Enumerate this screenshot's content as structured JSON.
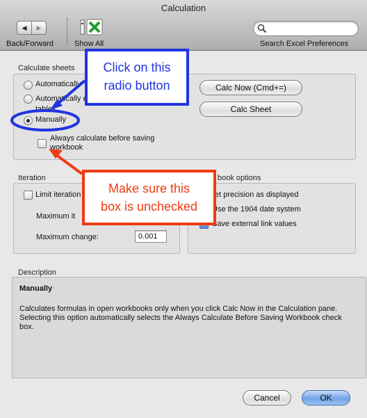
{
  "window": {
    "title": "Calculation"
  },
  "toolbar": {
    "back_forward_label": "Back/Forward",
    "show_all_label": "Show All",
    "search_label": "Search Excel Preferences",
    "search_placeholder": ""
  },
  "calculate_sheets": {
    "heading": "Calculate sheets",
    "options": [
      {
        "label": "Automatically",
        "selected": false
      },
      {
        "label": "Automatically except for data tables",
        "selected": false
      },
      {
        "label": "Manually",
        "selected": true
      }
    ],
    "always_calc": {
      "label_line1": "Always calculate before saving",
      "label_line2": "workbook",
      "checked": false
    },
    "calc_now_label": "Calc Now (Cmd+=)",
    "calc_sheet_label": "Calc Sheet"
  },
  "iteration": {
    "heading": "Iteration",
    "limit_label": "Limit iteration",
    "limit_checked": false,
    "max_iter_label": "Maximum it",
    "max_change_label": "Maximum change:",
    "max_change_value": "0.001"
  },
  "workbook_options": {
    "heading": "book options",
    "items": [
      {
        "label": "et precision as displayed",
        "checked": false
      },
      {
        "label": "Use the 1904 date system",
        "checked": false
      },
      {
        "label": "Save external link values",
        "checked": true
      }
    ]
  },
  "description": {
    "heading": "Description",
    "title": "Manually",
    "body": "Calculates formulas in open workbooks only when you click Calc Now in the Calculation pane. Selecting this option automatically selects the Always Calculate Before Saving Workbook check box."
  },
  "buttons": {
    "cancel": "Cancel",
    "ok": "OK"
  },
  "callouts": {
    "blue_line1": "Click on this",
    "blue_line2": "radio button",
    "red_line1": "Make sure this",
    "red_line2": "box is unchecked",
    "blue_color": "#1f35e0",
    "red_color": "#ee3a14"
  }
}
